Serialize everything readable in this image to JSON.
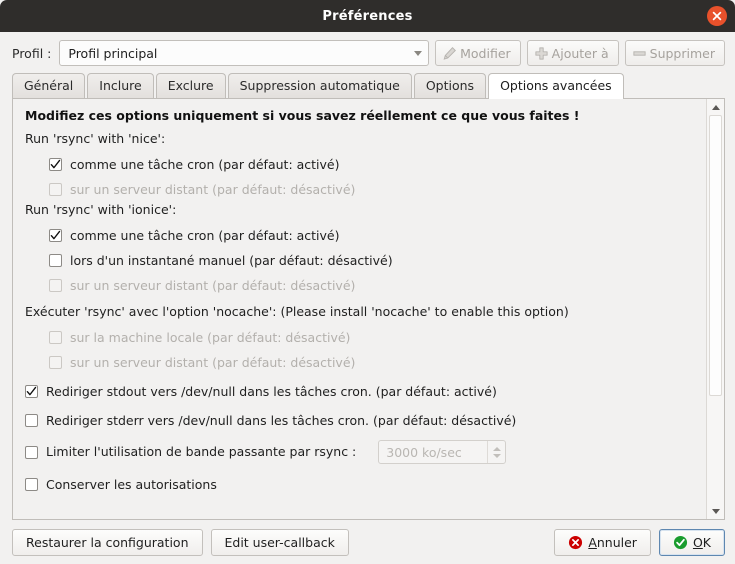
{
  "window": {
    "title": "Préférences",
    "close_icon": "close-icon"
  },
  "profile": {
    "label": "Profil :",
    "selected": "Profil principal",
    "dropdown_icon": "chevron-down-icon",
    "buttons": [
      {
        "label": "Modifier",
        "icon": "pencil-icon",
        "disabled": true
      },
      {
        "label": "Ajouter à",
        "icon": "plus-icon",
        "disabled": true
      },
      {
        "label": "Supprimer",
        "icon": "minus-icon",
        "disabled": true
      }
    ]
  },
  "tabs": [
    {
      "label": "Général",
      "active": false
    },
    {
      "label": "Inclure",
      "active": false
    },
    {
      "label": "Exclure",
      "active": false
    },
    {
      "label": "Suppression automatique",
      "active": false
    },
    {
      "label": "Options",
      "active": false
    },
    {
      "label": "Options avancées",
      "active": true
    }
  ],
  "content": {
    "warning": "Modifiez ces options uniquement si vous savez réellement ce que vous faites !",
    "group_nice": "Run 'rsync' with 'nice':",
    "nice_cron": "comme une tâche cron (par défaut: activé)",
    "nice_remote": "sur un serveur distant (par défaut: désactivé)",
    "group_ionice": "Run 'rsync' with 'ionice':",
    "ionice_cron": "comme une tâche cron (par défaut: activé)",
    "ionice_manual": "lors d'un instantané manuel (par défaut: désactivé)",
    "ionice_remote": "sur un serveur distant (par défaut: désactivé)",
    "group_nocache": "Exécuter 'rsync' avec l'option 'nocache': (Please install 'nocache' to enable this option)",
    "nocache_local": "sur la machine locale (par défaut: désactivé)",
    "nocache_remote": "sur un serveur distant (par défaut: désactivé)",
    "stdout": "Rediriger stdout vers /dev/null dans les tâches cron. (par défaut: activé)",
    "stderr": "Rediriger stderr vers /dev/null dans les tâches cron. (par défaut: désactivé)",
    "bandwidth": "Limiter l'utilisation de bande passante par rsync :",
    "bandwidth_value": "3000 ko/sec",
    "permissions": "Conserver les autorisations"
  },
  "actions": {
    "restore": "Restaurer la configuration",
    "edit_callback": "Edit user-callback",
    "cancel": "Annuler",
    "cancel_accel": "A",
    "ok": "OK",
    "ok_accel": "O",
    "cancel_icon": "cancel-circle-icon",
    "ok_icon": "check-circle-icon"
  },
  "colors": {
    "titlebar": "#2f2d2b",
    "close": "#e8512b",
    "cancel": "#cc0000",
    "ok": "#1a9c2e",
    "accent": "#5e87b0"
  }
}
